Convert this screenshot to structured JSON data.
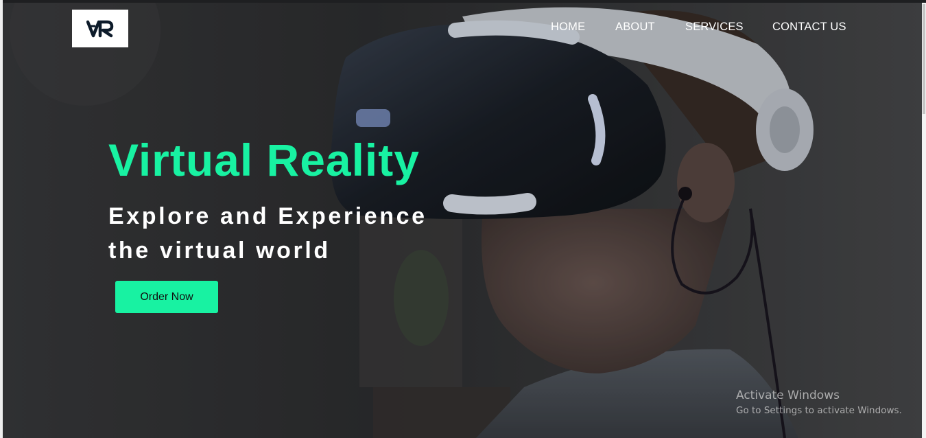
{
  "brand": {
    "logo_text": "VR"
  },
  "nav": {
    "items": [
      {
        "label": "HOME"
      },
      {
        "label": "ABOUT"
      },
      {
        "label": "SERVICES"
      },
      {
        "label": "CONTACT US"
      }
    ]
  },
  "hero": {
    "title": "Virtual Reality",
    "subtitle_line1": "Explore and Experience",
    "subtitle_line2": "the virtual world",
    "cta_label": "Order Now",
    "accent_color": "#18f2a2"
  },
  "watermark": {
    "title": "Activate Windows",
    "subtitle": "Go to Settings to activate Windows."
  }
}
